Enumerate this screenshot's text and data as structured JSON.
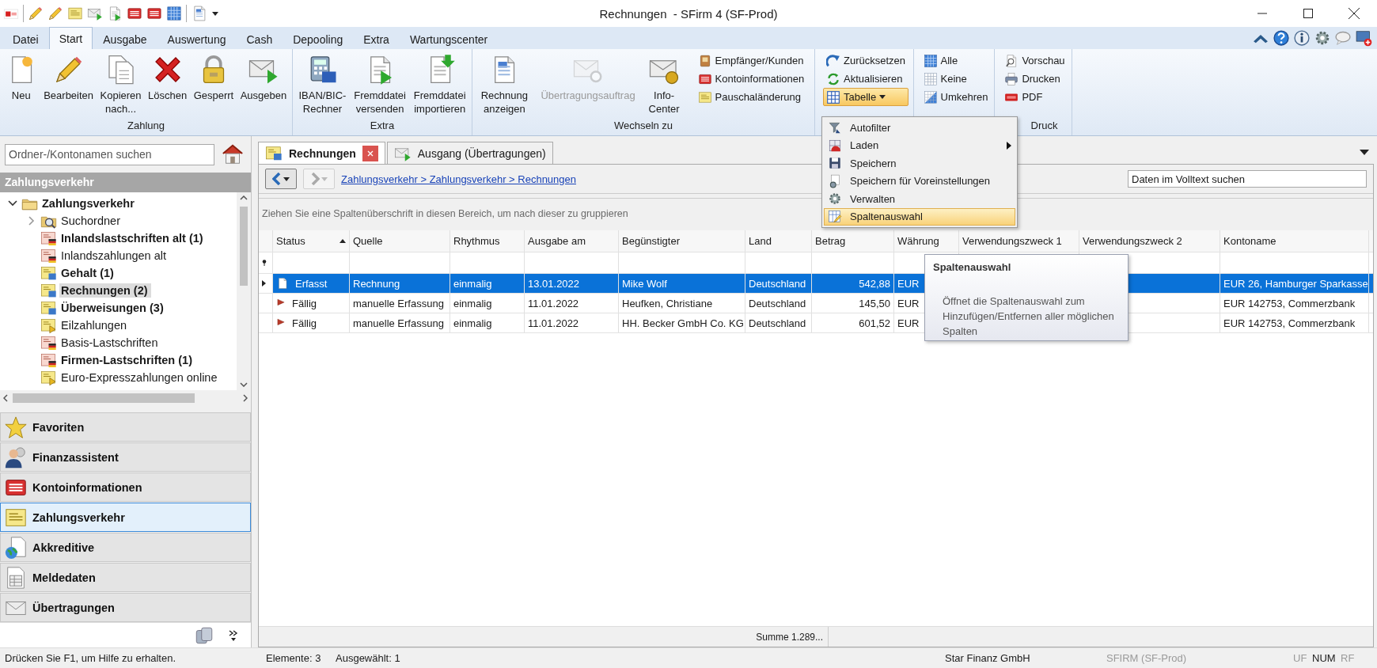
{
  "window": {
    "title": "Rechnungen  - SFirm 4 (SF-Prod)"
  },
  "menu_tabs": [
    {
      "label": "Datei",
      "selected": false
    },
    {
      "label": "Start",
      "selected": true
    },
    {
      "label": "Ausgabe",
      "selected": false
    },
    {
      "label": "Auswertung",
      "selected": false
    },
    {
      "label": "Cash",
      "selected": false
    },
    {
      "label": "Depooling",
      "selected": false
    },
    {
      "label": "Extra",
      "selected": false
    },
    {
      "label": "Wartungscenter",
      "selected": false
    }
  ],
  "ribbon": {
    "groups": [
      {
        "label": "Zahlung",
        "buttons": [
          {
            "kind": "large",
            "label": "Neu",
            "disabled": false
          },
          {
            "kind": "large",
            "label": "Bearbeiten",
            "disabled": false
          },
          {
            "kind": "large",
            "label": "Kopieren nach...",
            "disabled": false
          },
          {
            "kind": "large",
            "label": "Löschen",
            "disabled": false
          },
          {
            "kind": "large",
            "label": "Gesperrt",
            "disabled": false
          },
          {
            "kind": "large",
            "label": "Ausgeben",
            "disabled": false
          }
        ]
      },
      {
        "label": "Extra",
        "buttons": [
          {
            "kind": "large",
            "label": "IBAN/BIC-Rechner",
            "disabled": false
          },
          {
            "kind": "large",
            "label": "Fremddatei versenden",
            "disabled": false
          },
          {
            "kind": "large",
            "label": "Fremddatei importieren",
            "disabled": false
          }
        ]
      },
      {
        "label": "Wechseln zu",
        "buttons": [
          {
            "kind": "large",
            "label": "Rechnung anzeigen",
            "disabled": false
          },
          {
            "kind": "large",
            "label": "Übertragungsauftrag",
            "disabled": true
          },
          {
            "kind": "large",
            "label": "Info-Center",
            "disabled": false
          },
          {
            "kind": "small",
            "label": "Empfänger/Kunden",
            "disabled": false
          },
          {
            "kind": "small",
            "label": "Kontoinformationen",
            "disabled": false
          },
          {
            "kind": "small",
            "label": "Pauschaländerung",
            "disabled": false
          }
        ]
      },
      {
        "buttons": [
          {
            "kind": "small",
            "label": "Zurücksetzen",
            "disabled": false
          },
          {
            "kind": "small",
            "label": "Aktualisieren",
            "disabled": false
          },
          {
            "kind": "dropdown",
            "label": "Tabelle",
            "disabled": false,
            "open": true
          }
        ]
      },
      {
        "buttons": [
          {
            "kind": "small",
            "label": "Alle",
            "disabled": false
          },
          {
            "kind": "small",
            "label": "Keine",
            "disabled": false
          },
          {
            "kind": "small",
            "label": "Umkehren",
            "disabled": false
          }
        ]
      },
      {
        "label": "Druck",
        "buttons": [
          {
            "kind": "small",
            "label": "Vorschau",
            "disabled": false
          },
          {
            "kind": "small",
            "label": "Drucken",
            "disabled": false
          },
          {
            "kind": "small",
            "label": "PDF",
            "disabled": false
          }
        ]
      }
    ]
  },
  "table_menu": {
    "items": [
      {
        "label": "Autofilter",
        "selected": false,
        "has_submenu": false
      },
      {
        "label": "Laden",
        "selected": false,
        "has_submenu": true
      },
      {
        "label": "Speichern",
        "selected": false,
        "has_submenu": false
      },
      {
        "label": "Speichern für Voreinstellungen",
        "selected": false,
        "has_submenu": false
      },
      {
        "label": "Verwalten",
        "selected": false,
        "has_submenu": false
      },
      {
        "label": "Spaltenauswahl",
        "selected": true,
        "has_submenu": false
      }
    ]
  },
  "tooltip": {
    "title": "Spaltenauswahl",
    "text": "Öffnet die Spaltenauswahl zum Hinzufügen/Entfernen aller möglichen Spalten"
  },
  "sidebar": {
    "search": {
      "placeholder": "Ordner-/Kontonamen suchen"
    },
    "section_title": "Zahlungsverkehr",
    "tree": [
      {
        "label": "Zahlungsverkehr",
        "bold": true,
        "selected": false,
        "expanded": true,
        "children": [
          {
            "label": "Suchordner",
            "bold": false,
            "selected": false,
            "expanded": false,
            "has_children": true
          },
          {
            "label": "Inlandslastschriften alt (1)",
            "bold": true,
            "selected": false
          },
          {
            "label": "Inlandszahlungen alt",
            "bold": false,
            "selected": false
          },
          {
            "label": "Gehalt (1)",
            "bold": true,
            "selected": false
          },
          {
            "label": "Rechnungen  (2)",
            "bold": true,
            "selected": true
          },
          {
            "label": "Überweisungen (3)",
            "bold": true,
            "selected": false
          },
          {
            "label": "Eilzahlungen",
            "bold": false,
            "selected": false
          },
          {
            "label": "Basis-Lastschriften",
            "bold": false,
            "selected": false
          },
          {
            "label": "Firmen-Lastschriften (1)",
            "bold": true,
            "selected": false
          },
          {
            "label": "Euro-Expresszahlungen online",
            "bold": false,
            "selected": false
          }
        ]
      }
    ],
    "nav": [
      {
        "label": "Favoriten",
        "selected": false
      },
      {
        "label": "Finanzassistent",
        "selected": false
      },
      {
        "label": "Kontoinformationen",
        "selected": false
      },
      {
        "label": "Zahlungsverkehr",
        "selected": true
      },
      {
        "label": "Akkreditive",
        "selected": false
      },
      {
        "label": "Meldedaten",
        "selected": false
      },
      {
        "label": "Übertragungen",
        "selected": false
      }
    ]
  },
  "doc_tabs": [
    {
      "label": "Rechnungen",
      "selected": true,
      "closable": true
    },
    {
      "label": "Ausgang (Übertragungen)",
      "selected": false,
      "closable": false
    }
  ],
  "breadcrumb": "Zahlungsverkehr > Zahlungsverkehr > Rechnungen",
  "fulltext_search": {
    "placeholder": "Daten im Volltext suchen"
  },
  "group_hint": "Ziehen Sie eine Spaltenüberschrift in diesen Bereich, um nach dieser zu gruppieren",
  "table": {
    "columns": [
      {
        "label": "Status",
        "sorted_ascending": true
      },
      {
        "label": "Quelle"
      },
      {
        "label": "Rhythmus"
      },
      {
        "label": "Ausgabe am"
      },
      {
        "label": "Begünstigter"
      },
      {
        "label": "Land"
      },
      {
        "label": "Betrag",
        "numeric": true
      },
      {
        "label": "Währung"
      },
      {
        "label": "Verwendungszweck 1"
      },
      {
        "label": "Verwendungszweck 2"
      },
      {
        "label": "Kontoname"
      }
    ],
    "rows": [
      {
        "selected": true,
        "kind": "recorded",
        "cells": [
          "Erfasst",
          "Rechnung",
          "einmalig",
          "13.01.2022",
          "Mike Wolf",
          "Deutschland",
          "542,88",
          "EUR",
          null,
          null,
          "EUR 26, Hamburger Sparkasse"
        ]
      },
      {
        "selected": false,
        "kind": "due",
        "cells": [
          "Fällig",
          "manuelle Erfassung",
          "einmalig",
          "11.01.2022",
          "Heufken, Christiane",
          "Deutschland",
          "145,50",
          "EUR",
          null,
          null,
          "EUR 142753, Commerzbank"
        ]
      },
      {
        "selected": false,
        "kind": "due",
        "cells": [
          "Fällig",
          "manuelle Erfassung",
          "einmalig",
          "11.01.2022",
          "HH. Becker GmbH  Co. KG",
          "Deutschland",
          "601,52",
          "EUR",
          null,
          null,
          "EUR 142753, Commerzbank"
        ]
      }
    ],
    "summary": "Summe 1.289..."
  },
  "status_bar": [
    {
      "text": "Drücken Sie F1, um Hilfe zu erhalten.",
      "disabled": false
    },
    {
      "text": "Elemente: 3",
      "disabled": false
    },
    {
      "text": "Ausgewählt: 1",
      "disabled": false
    },
    {
      "text": "Star Finanz GmbH",
      "disabled": false
    },
    {
      "text": "SFIRM (SF-Prod)",
      "disabled": true
    },
    {
      "text": "UF",
      "disabled": true
    },
    {
      "text": "NUM",
      "disabled": false
    },
    {
      "text": "RF",
      "disabled": true
    }
  ]
}
